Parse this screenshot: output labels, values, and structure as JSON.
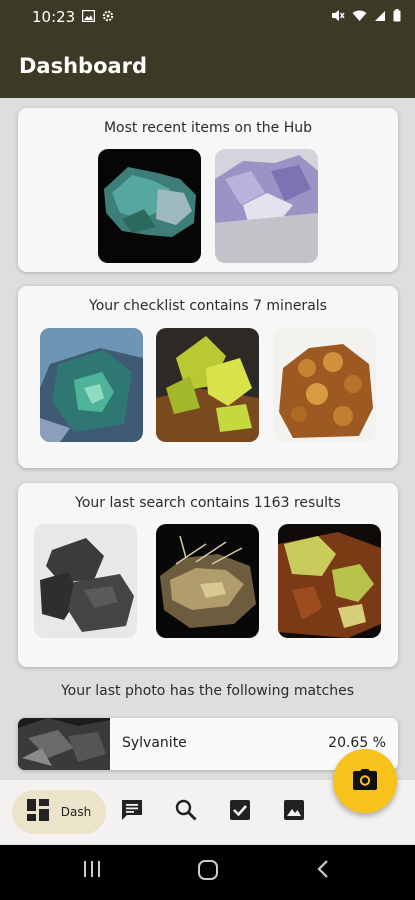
{
  "status_bar": {
    "time": "10:23"
  },
  "app_bar": {
    "title": "Dashboard"
  },
  "hub_card": {
    "title": "Most recent items on the Hub",
    "items": [
      {
        "alt": "green blue mineral on black"
      },
      {
        "alt": "purple fluorite crystals"
      }
    ]
  },
  "checklist_card": {
    "title": "Your checklist contains 7 minerals",
    "items": [
      {
        "alt": "green fluorite cube"
      },
      {
        "alt": "yellow green wulfenite crystals"
      },
      {
        "alt": "orange brown garnet cluster"
      }
    ]
  },
  "search_card": {
    "title": "Your last search contains 1163 results",
    "items": [
      {
        "alt": "dark grey mineral chunk"
      },
      {
        "alt": "tan needle crystal specimen"
      },
      {
        "alt": "yellow green and red mineral"
      }
    ]
  },
  "photo_section": {
    "title": "Your last photo has the following matches",
    "matches": [
      {
        "name": "Sylvanite",
        "score": "20.65 %"
      }
    ]
  },
  "bottom_nav": {
    "items": [
      {
        "label": "Dash",
        "icon": "dashboard-icon",
        "active": true
      },
      {
        "label": "",
        "icon": "chat-icon",
        "active": false
      },
      {
        "label": "",
        "icon": "search-icon",
        "active": false
      },
      {
        "label": "",
        "icon": "checkbox-icon",
        "active": false
      },
      {
        "label": "",
        "icon": "image-icon",
        "active": false
      }
    ]
  },
  "fab": {
    "icon": "camera-icon"
  },
  "colors": {
    "app_bar": "#3c3a26",
    "fab": "#f7c31b",
    "active_nav": "#ece3cb"
  }
}
